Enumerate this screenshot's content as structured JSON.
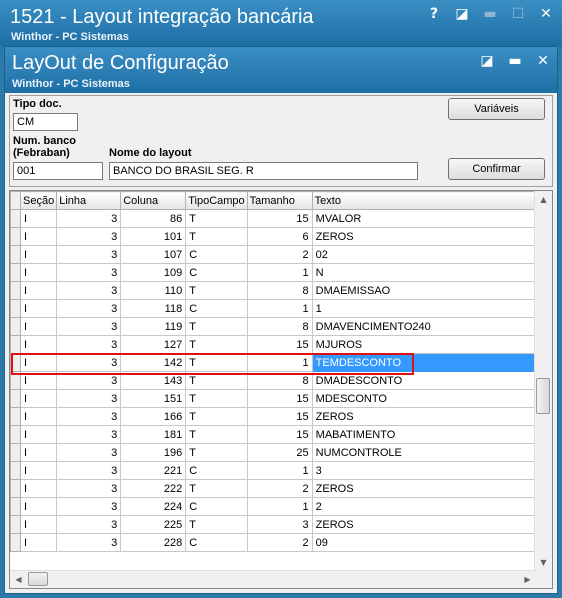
{
  "outer_window": {
    "title": "1521 - Layout integração bancária",
    "subtitle": "Winthor - PC Sistemas"
  },
  "inner_window": {
    "title": "LayOut de Configuração",
    "subtitle": "Winthor - PC Sistemas"
  },
  "form": {
    "tipo_doc_label": "Tipo doc.",
    "tipo_doc_value": "CM",
    "num_banco_label1": "Num. banco",
    "num_banco_label2": "(Febraban)",
    "num_banco_value": "001",
    "nome_layout_label": "Nome do layout",
    "nome_layout_value": "BANCO DO BRASIL SEG. R",
    "variaveis_button": "Variáveis",
    "confirmar_button": "Confirmar"
  },
  "grid": {
    "columns": [
      "Seção",
      "Linha",
      "Coluna",
      "TipoCampo",
      "Tamanho",
      "Texto"
    ],
    "selected_index": 8,
    "rows": [
      [
        "I",
        "3",
        "86",
        "T",
        "15",
        "MVALOR"
      ],
      [
        "I",
        "3",
        "101",
        "T",
        "6",
        "ZEROS"
      ],
      [
        "I",
        "3",
        "107",
        "C",
        "2",
        "02"
      ],
      [
        "I",
        "3",
        "109",
        "C",
        "1",
        "N"
      ],
      [
        "I",
        "3",
        "110",
        "T",
        "8",
        "DMAEMISSAO"
      ],
      [
        "I",
        "3",
        "118",
        "C",
        "1",
        "1"
      ],
      [
        "I",
        "3",
        "119",
        "T",
        "8",
        "DMAVENCIMENTO240"
      ],
      [
        "I",
        "3",
        "127",
        "T",
        "15",
        "MJUROS"
      ],
      [
        "I",
        "3",
        "142",
        "T",
        "1",
        "TEMDESCONTO"
      ],
      [
        "I",
        "3",
        "143",
        "T",
        "8",
        "DMADESCONTO"
      ],
      [
        "I",
        "3",
        "151",
        "T",
        "15",
        "MDESCONTO"
      ],
      [
        "I",
        "3",
        "166",
        "T",
        "15",
        "ZEROS"
      ],
      [
        "I",
        "3",
        "181",
        "T",
        "15",
        "MABATIMENTO"
      ],
      [
        "I",
        "3",
        "196",
        "T",
        "25",
        "NUMCONTROLE"
      ],
      [
        "I",
        "3",
        "221",
        "C",
        "1",
        "3"
      ],
      [
        "I",
        "3",
        "222",
        "T",
        "2",
        "ZEROS"
      ],
      [
        "I",
        "3",
        "224",
        "C",
        "1",
        "2"
      ],
      [
        "I",
        "3",
        "225",
        "T",
        "3",
        "ZEROS"
      ],
      [
        "I",
        "3",
        "228",
        "C",
        "2",
        "09"
      ]
    ]
  },
  "icons": {
    "help": "help-icon",
    "edit": "edit-icon",
    "minimize": "minimize-icon",
    "maximize": "maximize-icon",
    "close": "close-icon"
  },
  "colors": {
    "titlebar": "#2c7aa8",
    "selection": "#3399ff",
    "highlight_frame": "#e01010"
  }
}
